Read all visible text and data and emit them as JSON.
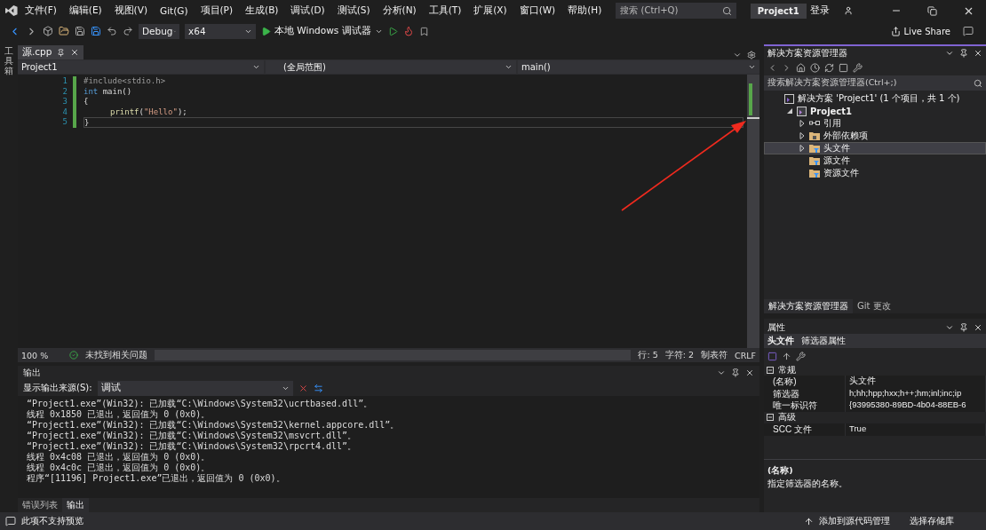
{
  "menu": {
    "items": [
      "文件(F)",
      "编辑(E)",
      "视图(V)",
      "Git(G)",
      "项目(P)",
      "生成(B)",
      "调试(D)",
      "测试(S)",
      "分析(N)",
      "工具(T)",
      "扩展(X)",
      "窗口(W)",
      "帮助(H)"
    ],
    "search": {
      "placeholder": "搜索 (Ctrl+Q)"
    },
    "project_badge": "Project1",
    "sign_in": "登录"
  },
  "toolbar": {
    "configuration": "Debug",
    "platform": "x64",
    "run_button": "本地 Windows 调试器",
    "live_share": "Live Share"
  },
  "toolbox_label": "工具箱",
  "editor": {
    "tabs": [
      {
        "label": "源.cpp",
        "selected": true
      }
    ],
    "nav": {
      "project": "Project1",
      "scope": "(全局范围)",
      "member": "main()"
    },
    "lines": [
      {
        "number": "1",
        "tokens": [
          {
            "kind": "preproc",
            "text": "#include<stdio.h>"
          }
        ]
      },
      {
        "number": "2",
        "tokens": [
          {
            "kind": "keyword",
            "text": "int"
          },
          {
            "kind": "plain",
            "text": " main()"
          }
        ]
      },
      {
        "number": "3",
        "tokens": [
          {
            "kind": "plain",
            "text": "{"
          }
        ]
      },
      {
        "number": "4",
        "indented": true,
        "tokens": [
          {
            "kind": "func",
            "text": "printf"
          },
          {
            "kind": "plain",
            "text": "("
          },
          {
            "kind": "string",
            "text": "\"Hello\""
          },
          {
            "kind": "plain",
            "text": ");"
          }
        ]
      },
      {
        "number": "5",
        "tokens": [
          {
            "kind": "plain",
            "text": "}"
          }
        ]
      }
    ],
    "status": {
      "zoom": "100 %",
      "issues": "未找到相关问题",
      "line": "行: 5",
      "char": "字符: 2",
      "indent": "制表符",
      "eol": "CRLF"
    }
  },
  "output": {
    "title": "输出",
    "source_label": "显示输出来源(S):",
    "source": "调试",
    "lines": [
      "“Project1.exe”(Win32): 已加载“C:\\Windows\\System32\\ucrtbased.dll”。",
      "线程 0x1850 已退出，返回值为 0 (0x0)。",
      "“Project1.exe”(Win32): 已加载“C:\\Windows\\System32\\kernel.appcore.dll”。",
      "“Project1.exe”(Win32): 已加载“C:\\Windows\\System32\\msvcrt.dll”。",
      "“Project1.exe”(Win32): 已加载“C:\\Windows\\System32\\rpcrt4.dll”。",
      "线程 0x4c08 已退出，返回值为 0 (0x0)。",
      "线程 0x4c0c 已退出，返回值为 0 (0x0)。",
      "程序“[11196] Project1.exe”已退出，返回值为 0 (0x0)。"
    ],
    "tabs": [
      {
        "label": "错误列表",
        "selected": false
      },
      {
        "label": "输出",
        "selected": true
      }
    ]
  },
  "solution_explorer": {
    "title": "解决方案资源管理器",
    "search": {
      "placeholder": "搜索解决方案资源管理器(Ctrl+;)"
    },
    "tree": [
      {
        "label": "解决方案 'Project1' (1 个项目，共 1 个)",
        "kind": "solution",
        "selected": false,
        "children": [
          {
            "label": "Project1",
            "kind": "project",
            "expanded": true,
            "selected": false,
            "children": [
              {
                "label": "引用",
                "kind": "references",
                "expanded": false,
                "selected": false
              },
              {
                "label": "外部依赖项",
                "kind": "external",
                "expanded": false,
                "selected": false
              },
              {
                "label": "头文件",
                "kind": "filter",
                "expanded": false,
                "selected": true
              },
              {
                "label": "源文件",
                "kind": "filter",
                "selected": false
              },
              {
                "label": "资源文件",
                "kind": "filter",
                "selected": false
              }
            ]
          }
        ]
      }
    ],
    "tabs": [
      {
        "label": "解决方案资源管理器",
        "selected": true
      },
      {
        "label": "Git 更改",
        "selected": false
      }
    ]
  },
  "properties": {
    "title": "属性",
    "object": "头文件",
    "object_type": "筛选器属性",
    "categories": [
      {
        "name": "常规",
        "expanded": true,
        "rows": [
          {
            "name": "(名称)",
            "value": "头文件"
          },
          {
            "name": "筛选器",
            "value": "h;hh;hpp;hxx;h++;hm;inl;inc;ip"
          },
          {
            "name": "唯一标识符",
            "value": "{93995380-89BD-4b04-88EB-6"
          }
        ]
      },
      {
        "name": "高级",
        "expanded": true,
        "rows": [
          {
            "name": "SCC 文件",
            "value": "True"
          }
        ]
      }
    ],
    "description": {
      "title": "(名称)",
      "text": "指定筛选器的名称。"
    }
  },
  "status_bar": {
    "message": "此项不支持预览",
    "source_control": "添加到源代码管理",
    "repository": "选择存储库"
  }
}
